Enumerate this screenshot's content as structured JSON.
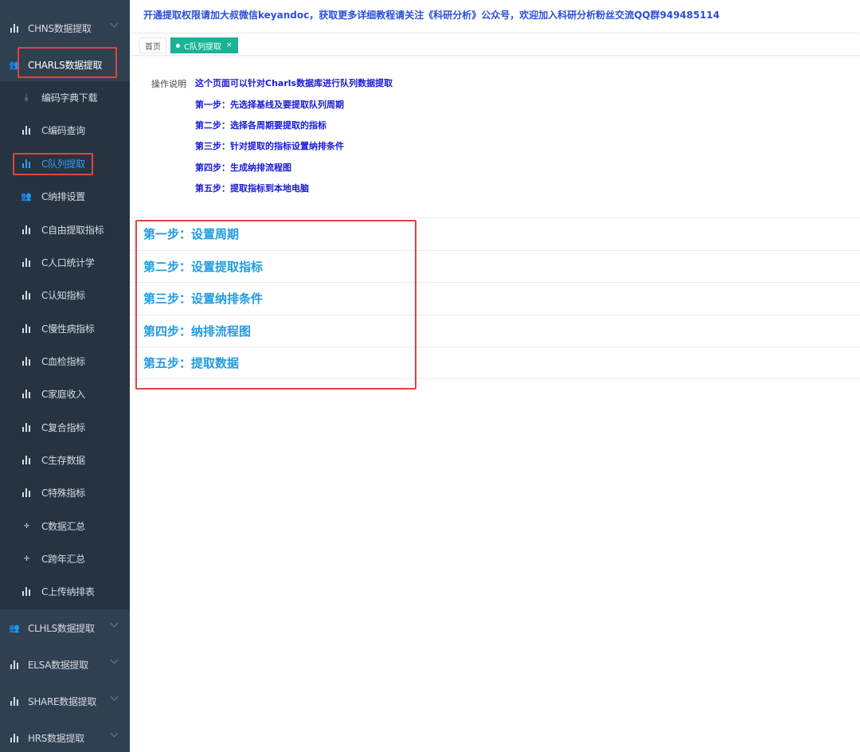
{
  "header": {
    "announcement": "开通提取权限请加大叔微信keyandoc，获取更多详细教程请关注《科研分析》公众号，欢迎加入科研分析粉丝交流QQ群949485114"
  },
  "tabs": [
    {
      "label": "首页"
    },
    {
      "label": "C队列提取",
      "close": "×"
    }
  ],
  "sidebar": {
    "top_items": [
      {
        "label": "CHNS数据提取",
        "icon": "bar-chart-icon"
      },
      {
        "label": "CHARLS数据提取",
        "icon": "person-icon"
      }
    ],
    "sub_items": [
      {
        "label": "编码字典下载",
        "icon": "download-icon"
      },
      {
        "label": "C编码查询",
        "icon": "bar-chart-icon"
      },
      {
        "label": "C队列提取",
        "icon": "bar-chart-icon"
      },
      {
        "label": "C纳排设置",
        "icon": "person-icon"
      },
      {
        "label": "C自由提取指标",
        "icon": "bar-chart-icon"
      },
      {
        "label": "C人口统计学",
        "icon": "bar-chart-icon"
      },
      {
        "label": "C认知指标",
        "icon": "bar-chart-icon"
      },
      {
        "label": "C慢性病指标",
        "icon": "bar-chart-icon"
      },
      {
        "label": "C血检指标",
        "icon": "bar-chart-icon"
      },
      {
        "label": "C家庭收入",
        "icon": "bar-chart-icon"
      },
      {
        "label": "C复合指标",
        "icon": "bar-chart-icon"
      },
      {
        "label": "C生存数据",
        "icon": "bar-chart-icon"
      },
      {
        "label": "C特殊指标",
        "icon": "bar-chart-icon"
      },
      {
        "label": "C数据汇总",
        "icon": "compress-icon"
      },
      {
        "label": "C跨年汇总",
        "icon": "compress-icon"
      },
      {
        "label": "C上传纳排表",
        "icon": "bar-chart-icon"
      }
    ],
    "bottom_items": [
      {
        "label": "CLHLS数据提取",
        "icon": "person-icon"
      },
      {
        "label": "ELSA数据提取",
        "icon": "bar-chart-icon"
      },
      {
        "label": "SHARE数据提取",
        "icon": "bar-chart-icon"
      },
      {
        "label": "HRS数据提取",
        "icon": "bar-chart-icon"
      }
    ]
  },
  "instructions": {
    "label": "操作说明",
    "lines": [
      "这个页面可以针对Charls数据库进行队列数据提取",
      "第一步：先选择基线及要提取队列周期",
      "第二步：选择各周期要提取的指标",
      "第三步：针对提取的指标设置纳排条件",
      "第四步：生成纳排流程图",
      "第五步：提取指标到本地电脑"
    ]
  },
  "steps": [
    "第一步：设置周期",
    "第二步：设置提取指标",
    "第三步：设置纳排条件",
    "第四步：纳排流程图",
    "第五步：提取数据"
  ],
  "colors": {
    "sidebar_bg": "#2f4050",
    "active_menu": "#3d9af1",
    "highlight_box": "#e0433e",
    "step_title": "#1e9be0",
    "tab_active": "#1ab394"
  }
}
